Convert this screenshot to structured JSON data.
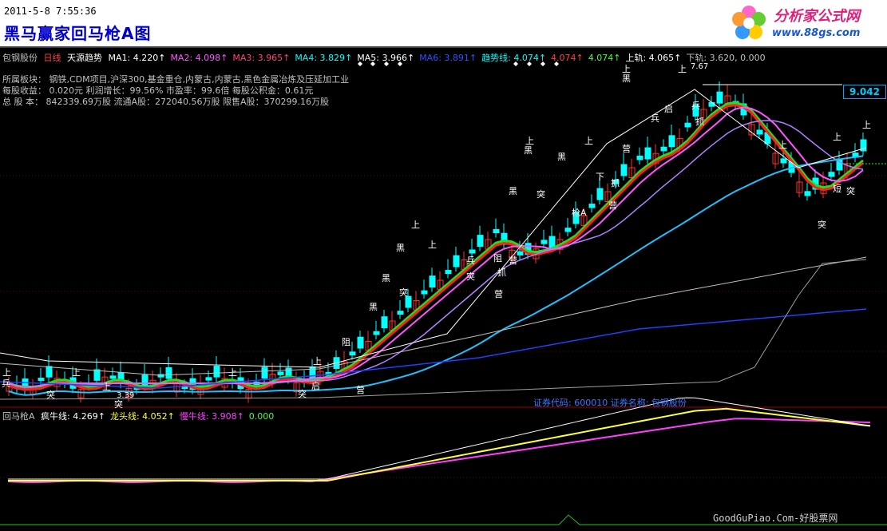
{
  "header": {
    "datetime": "2011-5-8 7:55:36",
    "title": "黑马赢家回马枪A图",
    "logo_name": "分析家公式网",
    "logo_url": "www.88gs.com"
  },
  "infobar": {
    "stock": "包钢股份",
    "period": "日线",
    "indicator": "天源趋势",
    "items": [
      {
        "text": "MA1: 4.220↑",
        "color": "#ffffff"
      },
      {
        "text": "MA2: 4.098↑",
        "color": "#ff55ff"
      },
      {
        "text": "MA3: 3.965↑",
        "color": "#ff4080"
      },
      {
        "text": "MA4: 3.829↑",
        "color": "#00ffff"
      },
      {
        "text": "MA5: 3.966↑",
        "color": "#ffffff"
      },
      {
        "text": "MA6: 3.891↑",
        "color": "#3050ff"
      },
      {
        "text": "趋势线: 4.074↑",
        "color": "#00ffff"
      },
      {
        "text": "4.074↑",
        "color": "#ff4040"
      },
      {
        "text": "4.074↑",
        "color": "#40ff40"
      },
      {
        "text": "上轨: 4.065↑",
        "color": "#ffffff"
      },
      {
        "text": "下轨: 3.620, 0.000",
        "color": "#c0c0c0"
      }
    ]
  },
  "fundamentals": {
    "line1": "所属板块：  钢铁,CDM项目,沪深300,基金重仓,内蒙古,内蒙古,黑色金属冶炼及压延加工业",
    "line2": "每股收益：  0.020元    利润增长：99.56%     市盈率：99.6倍    每股公积金：0.61元",
    "line3": "总 股 本：  842339.69万股   流通A股：272040.56万股   限售A股：370299.16万股"
  },
  "price_tag": "9.042",
  "peak_label": "7.67",
  "low_label": "3.39",
  "stock_info": "证券代码: 600010  证券名称: 包钢股份",
  "sub_panel": {
    "name": "回马枪A",
    "items": [
      {
        "text": "疯牛线: 4.269↑",
        "color": "#ffffff"
      },
      {
        "text": "龙头线: 4.052↑",
        "color": "#ffff40"
      },
      {
        "text": "慢牛线: 3.908↑",
        "color": "#ff40ff"
      },
      {
        "text": "0.000",
        "color": "#40ff40"
      }
    ]
  },
  "footer": "GoodGuPiao.Com-好股票网",
  "colors": {
    "up": "#ff3030",
    "down": "#00ffff",
    "ma1": "#ffffff",
    "green": "#20e020",
    "red": "#ff2020",
    "purple": "#b080ff",
    "cyan": "#20c0ff",
    "blue": "#2040ff"
  }
}
